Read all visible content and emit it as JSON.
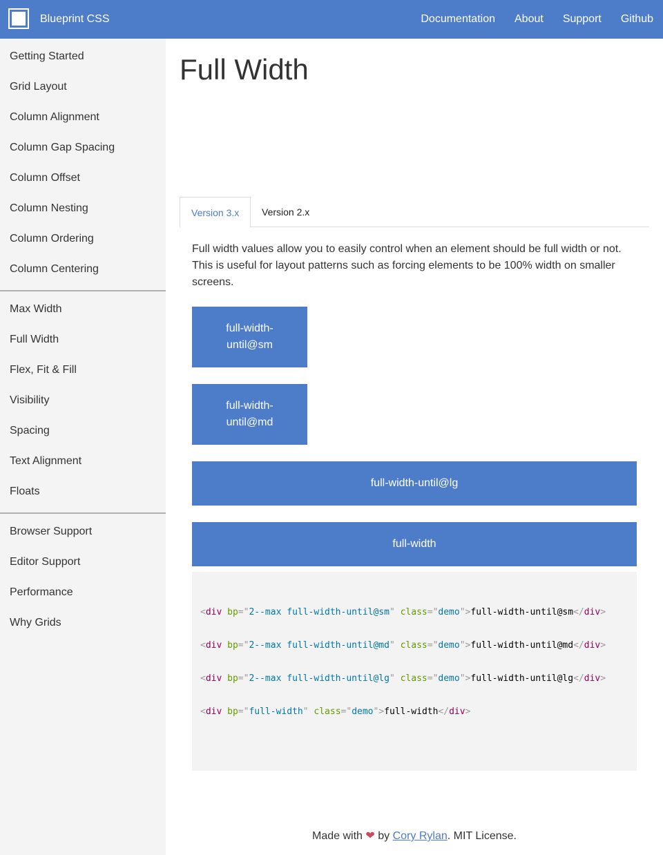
{
  "header": {
    "brand": "Blueprint CSS",
    "nav": [
      "Documentation",
      "About",
      "Support",
      "Github"
    ]
  },
  "sidebar": {
    "groups": [
      [
        "Getting Started",
        "Grid Layout",
        "Column Alignment",
        "Column Gap Spacing",
        "Column Offset",
        "Column Nesting",
        "Column Ordering",
        "Column Centering"
      ],
      [
        "Max Width",
        "Full Width",
        "Flex, Fit & Fill",
        "Visibility",
        "Spacing",
        "Text Alignment",
        "Floats"
      ],
      [
        "Browser Support",
        "Editor Support",
        "Performance",
        "Why Grids"
      ]
    ]
  },
  "main": {
    "title": "Full Width",
    "tabs": [
      "Version 3.x",
      "Version 2.x"
    ],
    "intro": "Full width values allow you to easily control when an element should be full width or not. This is useful for layout patterns such as forcing elements to be 100% width on smaller screens.",
    "demos": [
      "full-width-until@sm",
      "full-width-until@md",
      "full-width-until@lg",
      "full-width"
    ],
    "code": [
      {
        "tag": "div",
        "attr1": "bp",
        "val1": "2--max full-width-until@sm",
        "attr2": "class",
        "val2": "demo",
        "text": "full-width-until@sm"
      },
      {
        "tag": "div",
        "attr1": "bp",
        "val1": "2--max full-width-until@md",
        "attr2": "class",
        "val2": "demo",
        "text": "full-width-until@md"
      },
      {
        "tag": "div",
        "attr1": "bp",
        "val1": "2--max full-width-until@lg",
        "attr2": "class",
        "val2": "demo",
        "text": "full-width-until@lg"
      },
      {
        "tag": "div",
        "attr1": "bp",
        "val1": "full-width",
        "attr2": "class",
        "val2": "demo",
        "text": "full-width"
      }
    ]
  },
  "footer": {
    "made_with": "Made with",
    "by": "by",
    "author": "Cory Rylan",
    "license": ". MIT License."
  },
  "colors": {
    "primary": "#4d7cc9",
    "sidebar_bg": "#f4f4f4",
    "code_bg": "#f3f3f3",
    "heart": "#c9485b"
  }
}
